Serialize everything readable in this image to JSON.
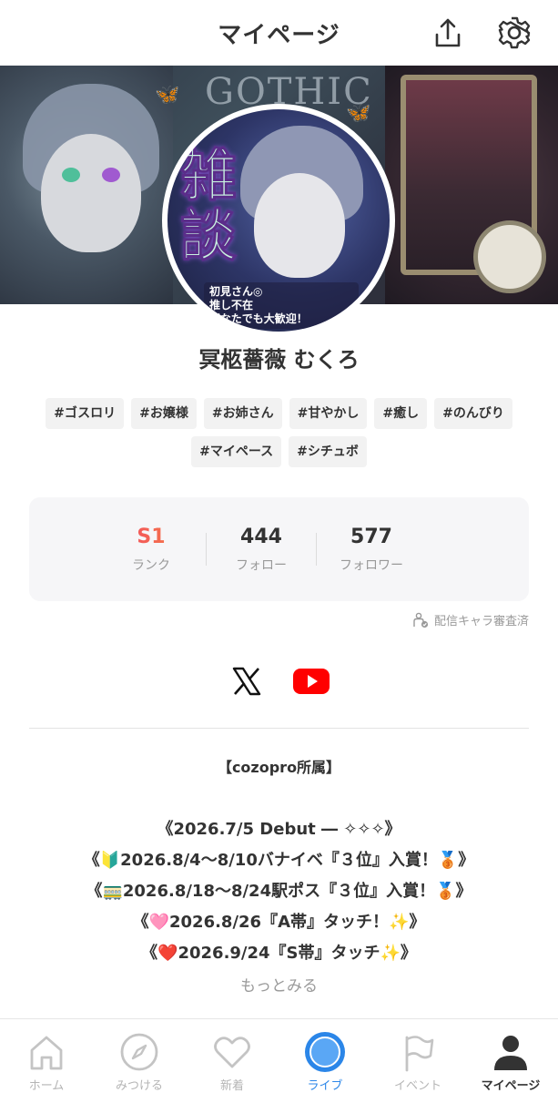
{
  "header": {
    "title": "マイページ",
    "share_icon": "share-icon",
    "settings_icon": "gear-icon"
  },
  "banner": {
    "logo_text": "GOTHIC"
  },
  "avatar": {
    "big_text": "雑談",
    "caption_lines": [
      "初見さん◎",
      "推し不在",
      "どなたでも大歓迎！"
    ]
  },
  "profile": {
    "name": "冥柩薔薇 むくろ"
  },
  "tags": [
    "#ゴスロリ",
    "#お嬢様",
    "#お姉さん",
    "#甘やかし",
    "#癒し",
    "#のんびり",
    "#マイペース",
    "#シチュボ"
  ],
  "stats": {
    "rank": {
      "value": "S1",
      "label": "ランク"
    },
    "follow": {
      "value": "444",
      "label": "フォロー"
    },
    "follower": {
      "value": "577",
      "label": "フォロワー"
    }
  },
  "verified": {
    "text": "配信キャラ審査済",
    "icon": "verified-character-icon"
  },
  "social": {
    "x_icon": "x-logo-icon",
    "youtube_icon": "youtube-icon"
  },
  "bio": {
    "heading": "【cozopro所属】",
    "lines": [
      "《2026.7/5 Debut ― ✧✧✧》",
      "《🔰2026.8/4〜8/10バナイベ『３位』入賞！🥉》",
      "《🚃2026.8/18〜8/24駅ポス『３位』入賞！🥉》",
      "《🩷2026.8/26『A帯』タッチ！✨》",
      "《❤️2026.9/24『S帯』タッチ✨》"
    ],
    "more": "もっとみる"
  },
  "tabbar": {
    "home": "ホーム",
    "discover": "みつける",
    "new": "新着",
    "live": "ライブ",
    "event": "イベント",
    "mypage": "マイページ"
  },
  "colors": {
    "accent_live": "#2b86e8",
    "rank_gradient_start": "#f23c6b",
    "rank_gradient_end": "#f58b3a",
    "youtube": "#ff0000"
  }
}
